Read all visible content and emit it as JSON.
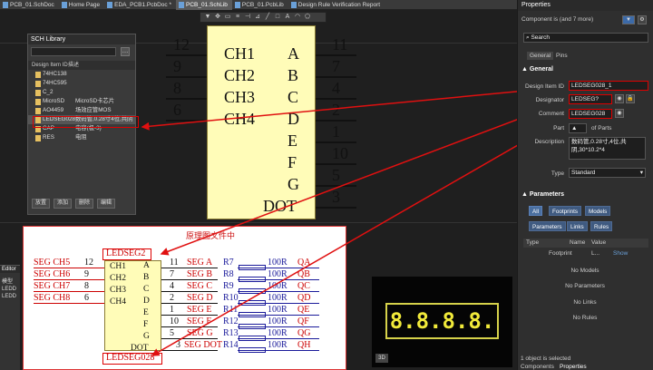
{
  "tabs": [
    "PCB_01.SchDoc",
    "Home Page",
    "EDA_PCB1.PcbDoc *",
    "PCB_01.SchLib",
    "PCB_01.PcbLib",
    "Design Rule Verification Report"
  ],
  "symbol": {
    "left_pins": [
      {
        "num": "12",
        "name": "CH1"
      },
      {
        "num": "9",
        "name": "CH2"
      },
      {
        "num": "8",
        "name": "CH3"
      },
      {
        "num": "6",
        "name": "CH4"
      }
    ],
    "right_pins": [
      {
        "num": "11",
        "name": "A"
      },
      {
        "num": "7",
        "name": "B"
      },
      {
        "num": "4",
        "name": "C"
      },
      {
        "num": "2",
        "name": "D"
      },
      {
        "num": "1",
        "name": "E"
      },
      {
        "num": "10",
        "name": "F"
      },
      {
        "num": "5",
        "name": "G"
      },
      {
        "num": "3",
        "name": "DOT"
      }
    ]
  },
  "library": {
    "title": "SCH Library",
    "col_id": "Design Item ID",
    "col_desc": "描述",
    "items": [
      {
        "id": "74HC138",
        "desc": ""
      },
      {
        "id": "74HC595",
        "desc": ""
      },
      {
        "id": "C_2",
        "desc": ""
      },
      {
        "id": "MicroSD",
        "desc": "MicroSD卡芯片"
      },
      {
        "id": "AO4459",
        "desc": "场效应管MOS"
      },
      {
        "id": "LEDSEG028",
        "desc": "数码管,0.28寸4位,共阴"
      },
      {
        "id": "CAP",
        "desc": "电容(极-3)"
      },
      {
        "id": "RES",
        "desc": "电阻"
      }
    ],
    "buttons": [
      "放置",
      "添加",
      "删除",
      "编辑"
    ]
  },
  "annotation": {
    "title": "原理图文件中",
    "top_label": "LEDSEG2",
    "bottom_label": "LEDSEG028",
    "left_nets": [
      {
        "net": "SEG CH5",
        "num": "12",
        "pin": "CH1"
      },
      {
        "net": "SEG CH6",
        "num": "9",
        "pin": "CH2"
      },
      {
        "net": "SEG CH7",
        "num": "8",
        "pin": "CH3"
      },
      {
        "net": "SEG CH8",
        "num": "6",
        "pin": "CH4"
      }
    ],
    "right_rows": [
      {
        "num": "11",
        "net": "SEG A",
        "r": "R7",
        "val": "100R",
        "out": "QA",
        "pin": "A"
      },
      {
        "num": "7",
        "net": "SEG B",
        "r": "R8",
        "val": "100R",
        "out": "QB",
        "pin": "B"
      },
      {
        "num": "4",
        "net": "SEG C",
        "r": "R9",
        "val": "100R",
        "out": "QC",
        "pin": "C"
      },
      {
        "num": "2",
        "net": "SEG D",
        "r": "R10",
        "val": "100R",
        "out": "QD",
        "pin": "D"
      },
      {
        "num": "1",
        "net": "SEG E",
        "r": "R11",
        "val": "100R",
        "out": "QE",
        "pin": "E"
      },
      {
        "num": "10",
        "net": "SEG F",
        "r": "R12",
        "val": "100R",
        "out": "QF",
        "pin": "F"
      },
      {
        "num": "5",
        "net": "SEG G",
        "r": "R13",
        "val": "100R",
        "out": "QG",
        "pin": "G"
      },
      {
        "num": "3",
        "net": "SEG DOT",
        "r": "R14",
        "val": "100R",
        "out": "QH",
        "pin": "DOT"
      }
    ]
  },
  "editor": {
    "title": "Editor",
    "label": "模型",
    "items": [
      "LEDD",
      "LEDD"
    ]
  },
  "view3d": {
    "digits": "8.8.8.8.",
    "tag": "3D"
  },
  "properties": {
    "title": "Properties",
    "filter_text": "Component is (and 7 more)",
    "search_placeholder": "Search",
    "tabs": [
      "General",
      "Pins"
    ],
    "general_header": "General",
    "design_item_id_label": "Design Item ID",
    "design_item_id": "LEDSEG028_1",
    "designator_label": "Designator",
    "designator": "LEDSEG?",
    "comment_label": "Comment",
    "comment": "LEDSEG028",
    "part_label": "Part",
    "part_of": "of Parts",
    "description_label": "Description",
    "description": "数码管,0.28寸,4位,共阴,30*10.2*4",
    "type_label": "Type",
    "type": "Standard",
    "params_header": "Parameters",
    "param_buttons": [
      "All",
      "Footprints",
      "Models",
      "Parameters",
      "Links",
      "Rules"
    ],
    "table_col_type": "Type",
    "table_col_name": "Name",
    "table_col_value": "Value",
    "footprint_row": {
      "type": "Footprint",
      "name": "L...",
      "show": "Show"
    },
    "empty_states": [
      "No Models",
      "No Parameters",
      "No Links",
      "No Rules"
    ],
    "status": "1 object is selected",
    "bottom_tabs": [
      "Components",
      "Properties"
    ]
  }
}
